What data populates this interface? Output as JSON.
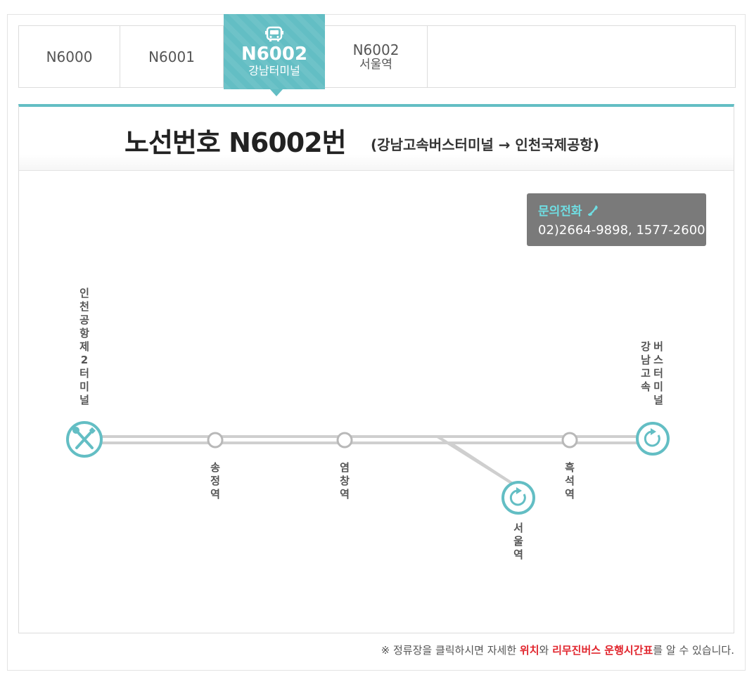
{
  "tabs": [
    {
      "line1": "N6000",
      "line2": ""
    },
    {
      "line1": "N6001",
      "line2": ""
    },
    {
      "line1": "N6002",
      "line2": "강남터미널"
    },
    {
      "line1": "N6002",
      "line2": "서울역"
    }
  ],
  "active_tab_icon": "bus-icon",
  "header": {
    "title": "노선번호 N6002번",
    "subtitle": "(강남고속버스터미널 → 인천국제공항)"
  },
  "contact": {
    "label": "문의전화",
    "icon": "phone-icon",
    "phone": "02)2664-9898, 1577-2600"
  },
  "stops": {
    "airport": "인천공항제2터미널",
    "songjeong": "송정역",
    "yeomchang": "염창역",
    "seoul": "서울역",
    "heukseok": "흑석역",
    "gangnam_col1": "강남고속",
    "gangnam_col2": "버스터미널"
  },
  "footer": {
    "prefix": "※ 정류장을 클릭하시면 자세한 ",
    "location": "위치",
    "mid": "와 ",
    "timetable": "리무진버스 운행시간표",
    "suffix": "를 알 수 있습니다."
  },
  "colors": {
    "accent": "#63bec4",
    "route_line": "#cfcfcf",
    "red": "#e1252d"
  }
}
